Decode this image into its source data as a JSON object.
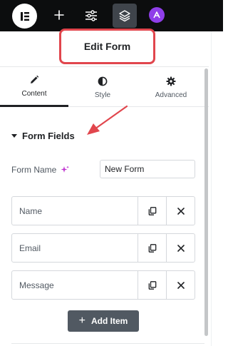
{
  "panel": {
    "title": "Edit Form"
  },
  "tabs": [
    {
      "label": "Content",
      "icon": "pencil-icon"
    },
    {
      "label": "Style",
      "icon": "half-circle-icon"
    },
    {
      "label": "Advanced",
      "icon": "gear-icon"
    }
  ],
  "section": {
    "title": "Form Fields"
  },
  "form_name": {
    "label": "Form Name",
    "value": "New Form"
  },
  "fields": [
    {
      "label": "Name"
    },
    {
      "label": "Email"
    },
    {
      "label": "Message"
    }
  ],
  "add_button": {
    "label": "Add Item"
  },
  "colors": {
    "topbar": "#0c0d0e",
    "highlight": "#e1464d",
    "ai_badge": "#8f3ee9",
    "sparkle": "#c036d0",
    "add_button": "#515962"
  }
}
